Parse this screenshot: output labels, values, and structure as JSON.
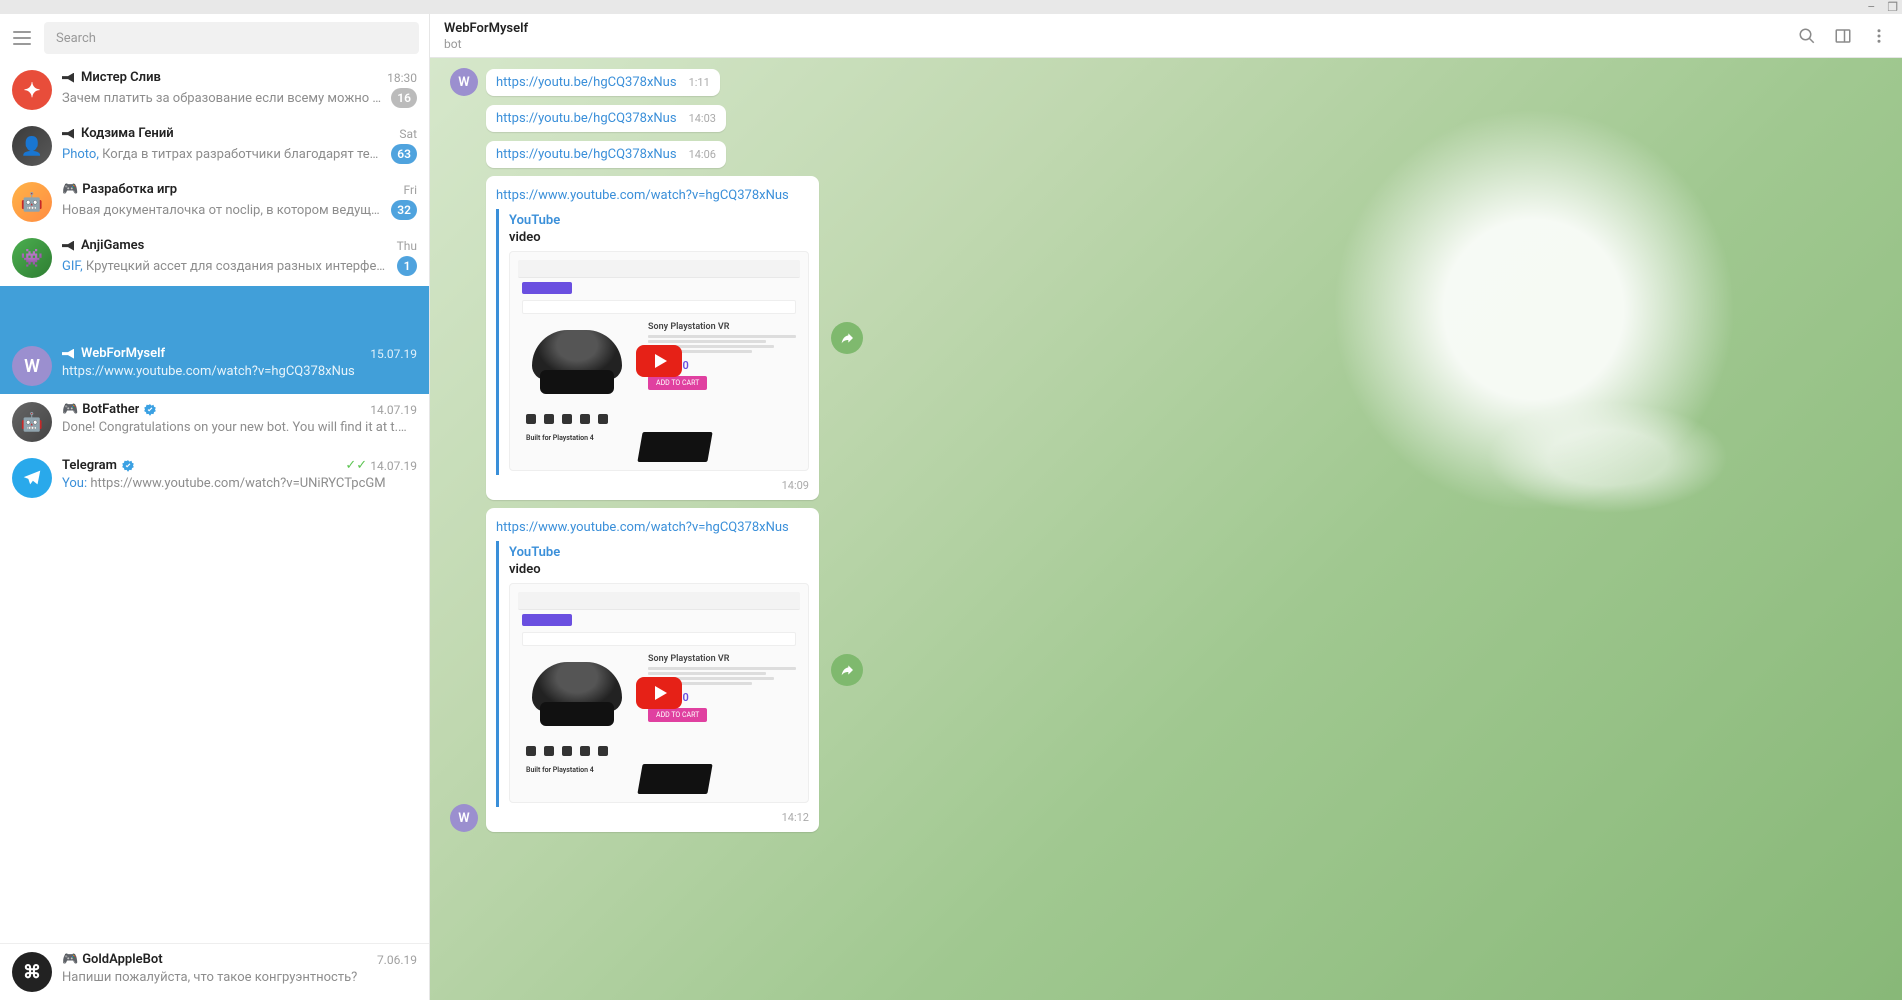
{
  "window": {
    "minimize": "–",
    "maximize": "❐",
    "close": ""
  },
  "sidebar": {
    "search_placeholder": "Search",
    "items": [
      {
        "name": "Мистер Слив",
        "preview": "Зачем платить за образование если всему можно обучиться беспл...",
        "time": "18:30",
        "badge": "16",
        "badge_blue": false,
        "horn": true,
        "bot": false
      },
      {
        "name": "Кодзима Гений",
        "prefix": "Photo, ",
        "preview": "Когда в титрах разработчики благодарят тебя за игру",
        "time": "Sat",
        "badge": "63",
        "badge_blue": true,
        "horn": true,
        "bot": false
      },
      {
        "name": "Разработка игр",
        "prefix": "",
        "preview": "Новая документалочка от noclip, в котором ведущий писатель студ...",
        "time": "Fri",
        "badge": "32",
        "badge_blue": true,
        "horn": false,
        "bot": true,
        "bot_prefix": "🎮"
      },
      {
        "name": "AnjiGames",
        "prefix": "GIF, ",
        "preview": "Крутецкий ассет для создания разных интерфейсных округлосте...",
        "time": "Thu",
        "badge": "1",
        "badge_blue": true,
        "horn": true,
        "bot": false
      },
      {
        "name": "WebForMyself",
        "prefix": "",
        "preview": "https://www.youtube.com/watch?v=hgCQ378xNus",
        "time": "15.07.19",
        "selected": true,
        "horn": true
      },
      {
        "name": "BotFather",
        "prefix": "",
        "preview": "Done! Congratulations on your new bot. You will find it at t.me/epiclegend_b...",
        "time": "14.07.19",
        "verified": true,
        "bot": true
      },
      {
        "name": "Telegram",
        "prefix": "You: ",
        "preview": "https://www.youtube.com/watch?v=UNiRYCTpcGM",
        "time": "14.07.19",
        "verified": true,
        "read": true
      },
      {
        "name": "GoldAppleBot",
        "prefix": "",
        "preview": "Напиши пожалуйста, что такое конгруэнтность?",
        "time": "7.06.19",
        "bot": true
      }
    ]
  },
  "chat": {
    "title": "WebForMyself",
    "subtitle": "bot",
    "avatar_letter": "W",
    "messages": [
      {
        "kind": "link",
        "text": "https://youtu.be/hgCQ378xNus",
        "time": "1:11",
        "show_avatar": true
      },
      {
        "kind": "link",
        "text": "https://youtu.be/hgCQ378xNus",
        "time": "14:03",
        "show_avatar": false
      },
      {
        "kind": "link",
        "text": "https://youtu.be/hgCQ378xNus",
        "time": "14:06",
        "show_avatar": false
      },
      {
        "kind": "rich",
        "text": "https://www.youtube.com/watch?v=hgCQ378xNus",
        "site": "YouTube",
        "ptitle": "video",
        "time": "14:09",
        "share": true,
        "show_avatar": false
      },
      {
        "kind": "rich",
        "text": "https://www.youtube.com/watch?v=hgCQ378xNus",
        "site": "YouTube",
        "ptitle": "video",
        "time": "14:12",
        "share": true,
        "show_avatar": true
      }
    ],
    "thumb": {
      "product": "Sony Playstation VR",
      "price": "$390.00",
      "cart": "ADD TO CART",
      "ps4": "Built for Playstation 4"
    }
  }
}
